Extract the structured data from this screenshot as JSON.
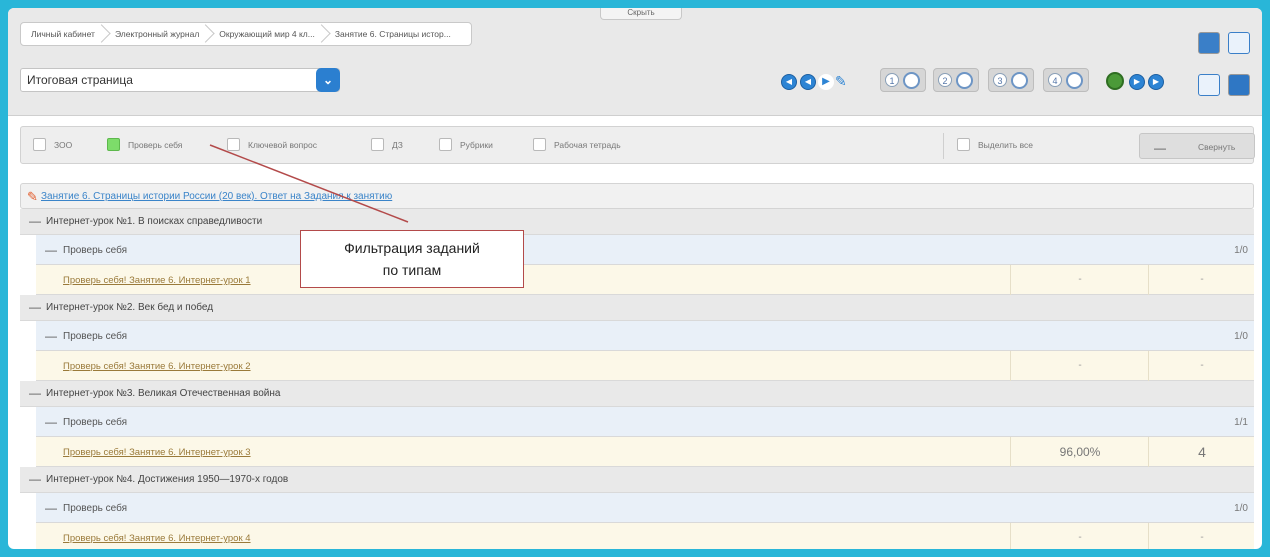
{
  "topbar": {
    "hide_label": "Скрыть",
    "breadcrumbs": [
      "Личный кабинет",
      "Электронный журнал",
      "Окружающий мир 4 кл...",
      "Занятие 6. Страницы истор..."
    ],
    "select_value": "Итоговая страница",
    "lesson_numbers": [
      "1",
      "2",
      "3",
      "4"
    ]
  },
  "filters": {
    "items": [
      {
        "label": "ЗОО",
        "checked": false
      },
      {
        "label": "Проверь себя",
        "checked": true
      },
      {
        "label": "Ключевой вопрос",
        "checked": false
      },
      {
        "label": "ДЗ",
        "checked": false
      },
      {
        "label": "Рубрики",
        "checked": false
      },
      {
        "label": "Рабочая тетрадь",
        "checked": false
      }
    ],
    "select_all": "Выделить все",
    "collapse_dash": "—",
    "collapse_label": "Свернуть"
  },
  "lesson_link": "Занятие 6. Страницы истории России (20 век). Ответ на Задания к занятию",
  "topics": [
    {
      "title": "Интернет-урок №1. В поисках справедливости",
      "sub": "Проверь себя",
      "count": "1/0",
      "task": "Проверь себя! Занятие 6. Интернет-урок 1",
      "score": "-",
      "mark": "-"
    },
    {
      "title": "Интернет-урок №2. Век бед и побед",
      "sub": "Проверь себя",
      "count": "1/0",
      "task": "Проверь себя! Занятие 6. Интернет-урок 2",
      "score": "-",
      "mark": "-"
    },
    {
      "title": "Интернет-урок №3. Великая Отечественная война",
      "sub": "Проверь себя",
      "count": "1/1",
      "task": "Проверь себя! Занятие 6. Интернет-урок 3",
      "score": "96,00%",
      "mark": "4"
    },
    {
      "title": "Интернет-урок №4. Достижения 1950—1970-х годов",
      "sub": "Проверь себя",
      "count": "1/0",
      "task": "Проверь себя! Занятие 6. Интернет-урок 4",
      "score": "-",
      "mark": "-"
    }
  ],
  "callout": {
    "line1": "Фильтрация заданий",
    "line2": "по типам"
  },
  "colors": {
    "accent": "#2b7fd0",
    "background": "#29b6d8",
    "callout_border": "#b34a4a",
    "green": "#7ddc6a"
  }
}
